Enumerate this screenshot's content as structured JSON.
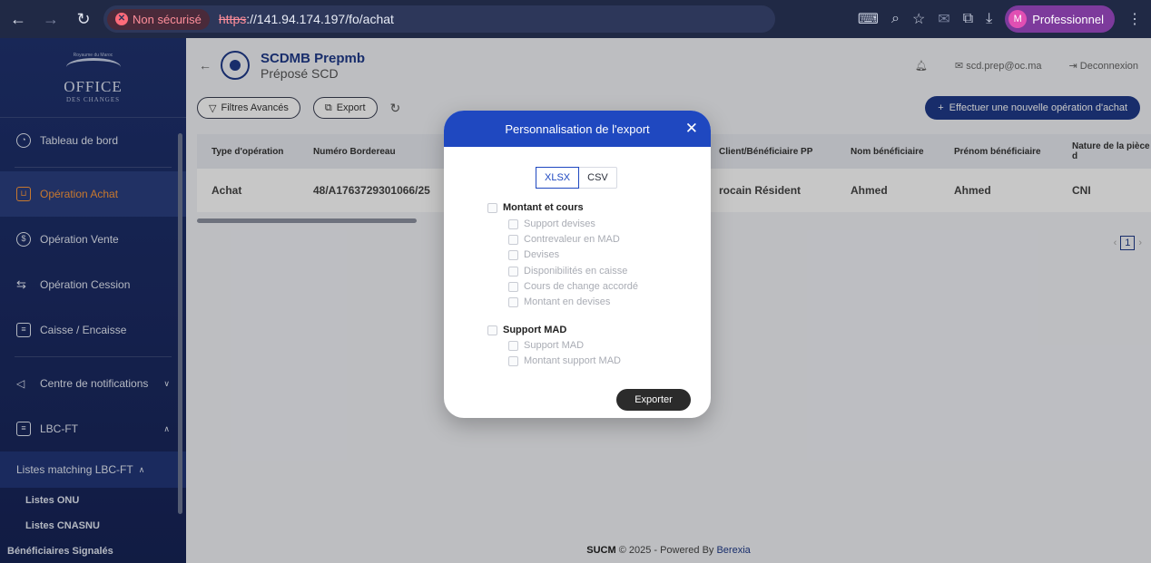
{
  "browser": {
    "security": "Non sécurisé",
    "url_proto": "https",
    "url_rest": "://141.94.174.197/fo/achat",
    "profile_initial": "M",
    "profile_name": "Professionnel"
  },
  "sidebar": {
    "logo_line": "OFFICE",
    "logo_sub": "DES CHANGES",
    "logo_top": "Royaume du Maroc",
    "items": [
      {
        "label": "Tableau de bord",
        "icon": "gauge-icon"
      },
      {
        "label": "Opération Achat",
        "icon": "cart-icon",
        "active": true
      },
      {
        "label": "Opération Vente",
        "icon": "dollar-icon"
      },
      {
        "label": "Opération Cession",
        "icon": "swap-icon"
      },
      {
        "label": "Caisse / Encaisse",
        "icon": "register-icon"
      },
      {
        "label": "Centre de notifications",
        "icon": "send-icon"
      },
      {
        "label": "LBC-FT",
        "icon": "document-icon"
      }
    ],
    "sub_title": "Listes matching LBC-FT",
    "sub_items": [
      "Listes ONU",
      "Listes CNASNU",
      "Bénéficiaires Signalés"
    ]
  },
  "header": {
    "name": "SCDMB Prepmb",
    "role": "Préposé SCD",
    "email": "scd.prep@oc.ma",
    "logout": "Deconnexion"
  },
  "toolbar": {
    "filters": "Filtres Avancés",
    "export": "Export",
    "new_operation": "Effectuer une nouvelle opération d'achat"
  },
  "table": {
    "headers": [
      "Type d'opération",
      "Numéro Bordereau",
      "",
      "Client/Bénéficiaire PP",
      "Nom bénéficiaire",
      "Prénom bénéficiaire",
      "Nature de la pièce d"
    ],
    "rows": [
      [
        "Achat",
        "48/A1763729301066/25",
        "",
        "rocain Résident",
        "Ahmed",
        "Ahmed",
        "CNI"
      ]
    ]
  },
  "pager": {
    "current": "1"
  },
  "footer": {
    "app": "SUCM",
    "text": "© 2025 - Powered By",
    "brand": "Berexia"
  },
  "modal": {
    "title": "Personnalisation de l'export",
    "formats": [
      "XLSX",
      "CSV"
    ],
    "selected_format": "XLSX",
    "group1": "Montant et cours",
    "group1_items": [
      "Support devises",
      "Contrevaleur en MAD",
      "Devises",
      "Disponibilités en caisse",
      "Cours de change accordé",
      "Montant en devises"
    ],
    "group2": "Support MAD",
    "group2_items": [
      "Support MAD",
      "Montant support MAD"
    ],
    "submit": "Exporter"
  }
}
